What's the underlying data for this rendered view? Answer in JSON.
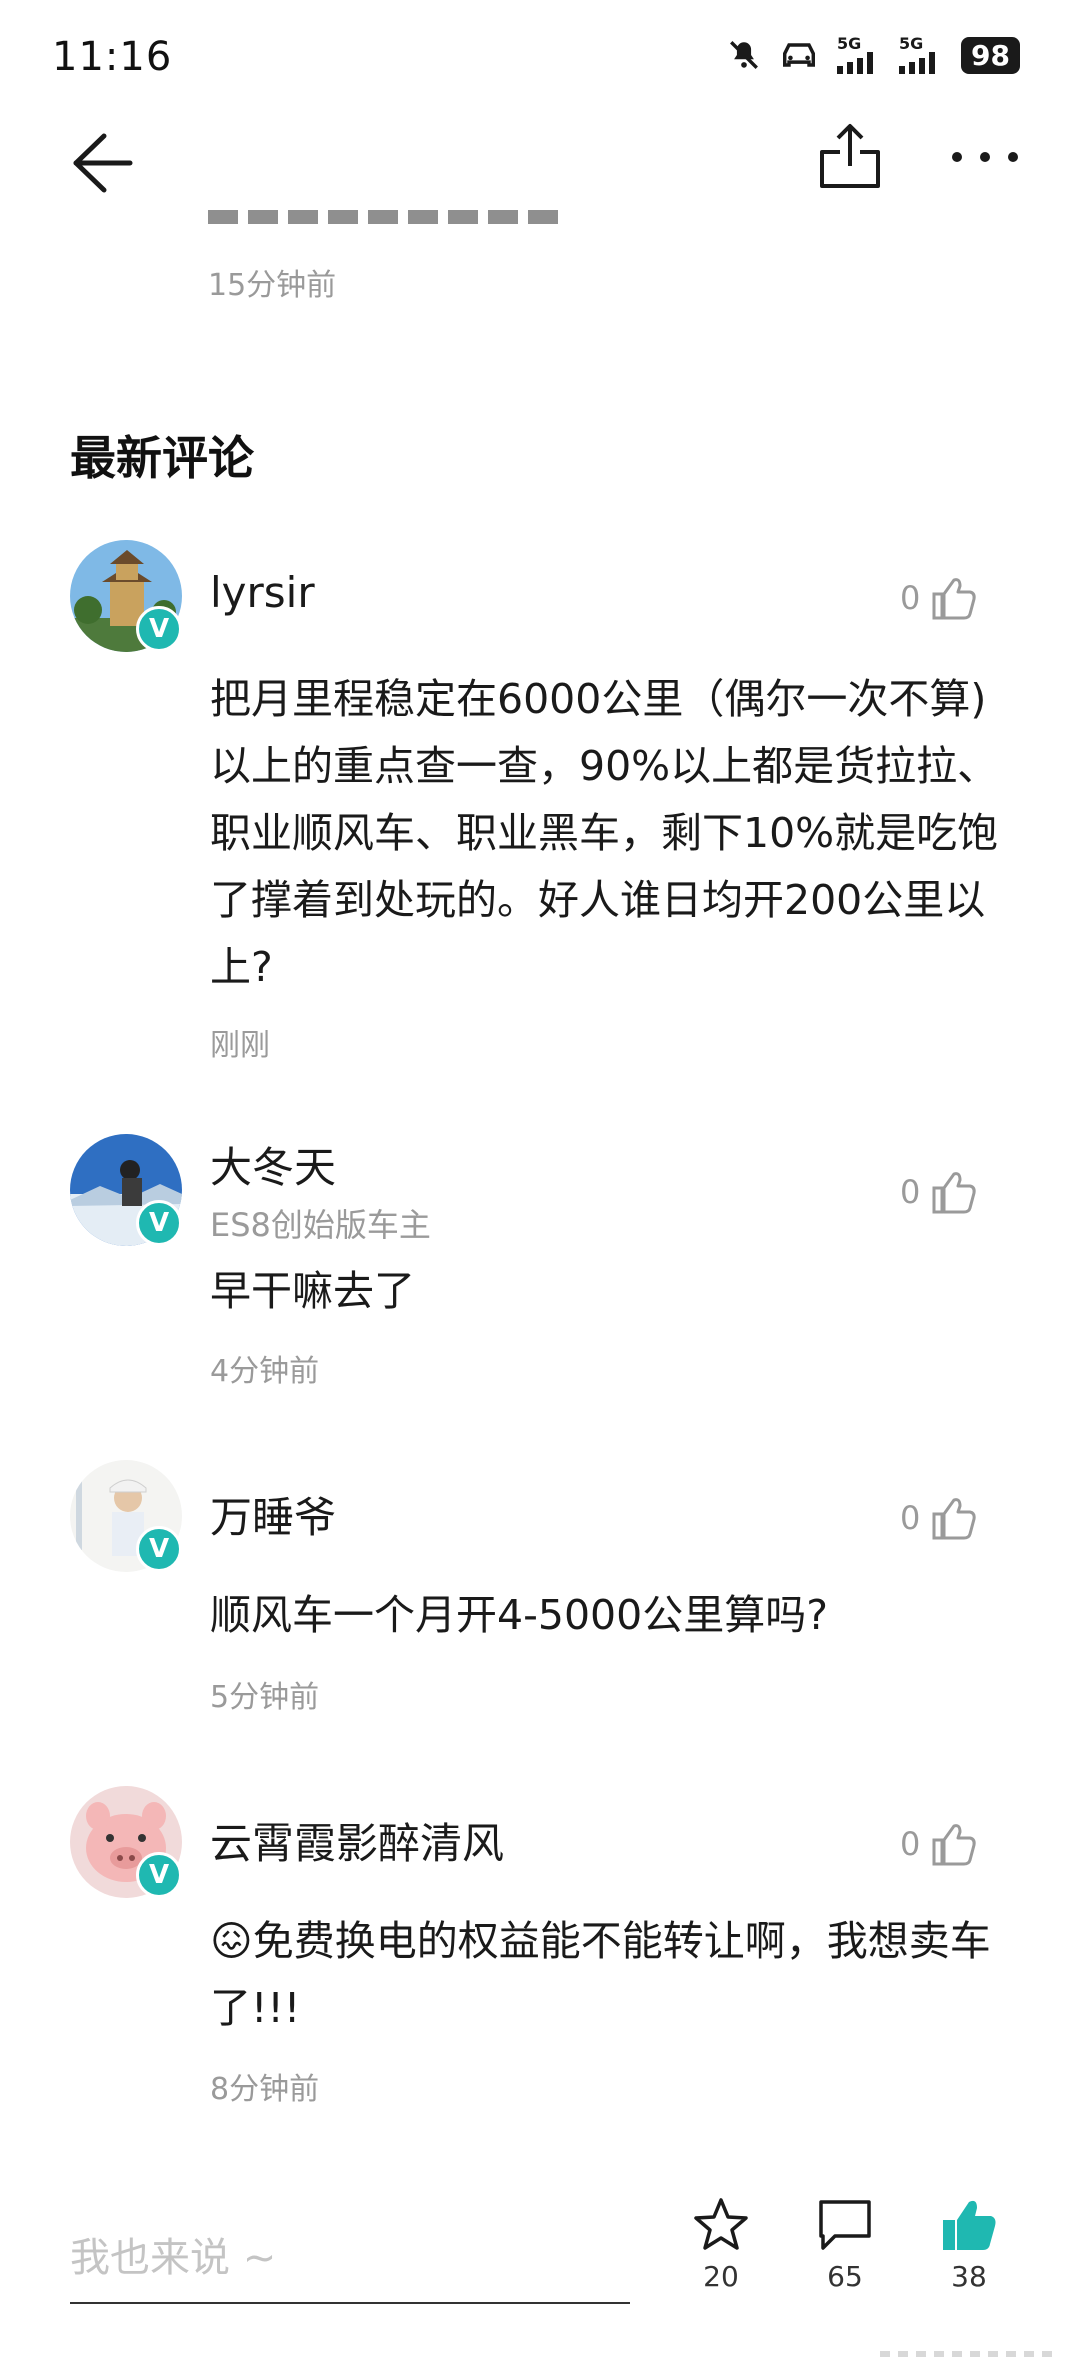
{
  "status_bar": {
    "time": "11:16",
    "signal1": "5G",
    "signal2": "5G",
    "battery": "98"
  },
  "prev_comment": {
    "time": "15分钟前"
  },
  "section": {
    "title": "最新评论"
  },
  "comments": [
    {
      "name": "lyrsir",
      "subtitle": "",
      "text": "把月里程稳定在6000公里（偶尔一次不算)以上的重点查一查，90%以上都是货拉拉、职业顺风车、职业黑车，剩下10%就是吃饱了撑着到处玩的。好人谁日均开200公里以上?",
      "time": "刚刚",
      "likes": "0"
    },
    {
      "name": "大冬天",
      "subtitle": "ES8创始版车主",
      "text": "早干嘛去了",
      "time": "4分钟前",
      "likes": "0"
    },
    {
      "name": "万睡爷",
      "subtitle": "",
      "text": "顺风车一个月开4-5000公里算吗?",
      "time": "5分钟前",
      "likes": "0"
    },
    {
      "name": "云霄霞影醉清风",
      "subtitle": "",
      "text": "免费换电的权益能不能转让啊，我想卖车了!!!",
      "emoji": "😖",
      "time": "8分钟前",
      "likes": "0"
    }
  ],
  "badge": "V",
  "bottom_bar": {
    "input_placeholder": "我也来说 ~",
    "favorites": "20",
    "comments": "65",
    "likes": "38"
  },
  "colors": {
    "accent": "#1fb8b1",
    "meta_text": "#9a9a9a"
  },
  "icons": [
    "back-arrow-icon",
    "share-icon",
    "more-icon",
    "thumbs-up-icon",
    "star-icon",
    "comment-icon",
    "mute-bell-icon",
    "car-icon"
  ]
}
